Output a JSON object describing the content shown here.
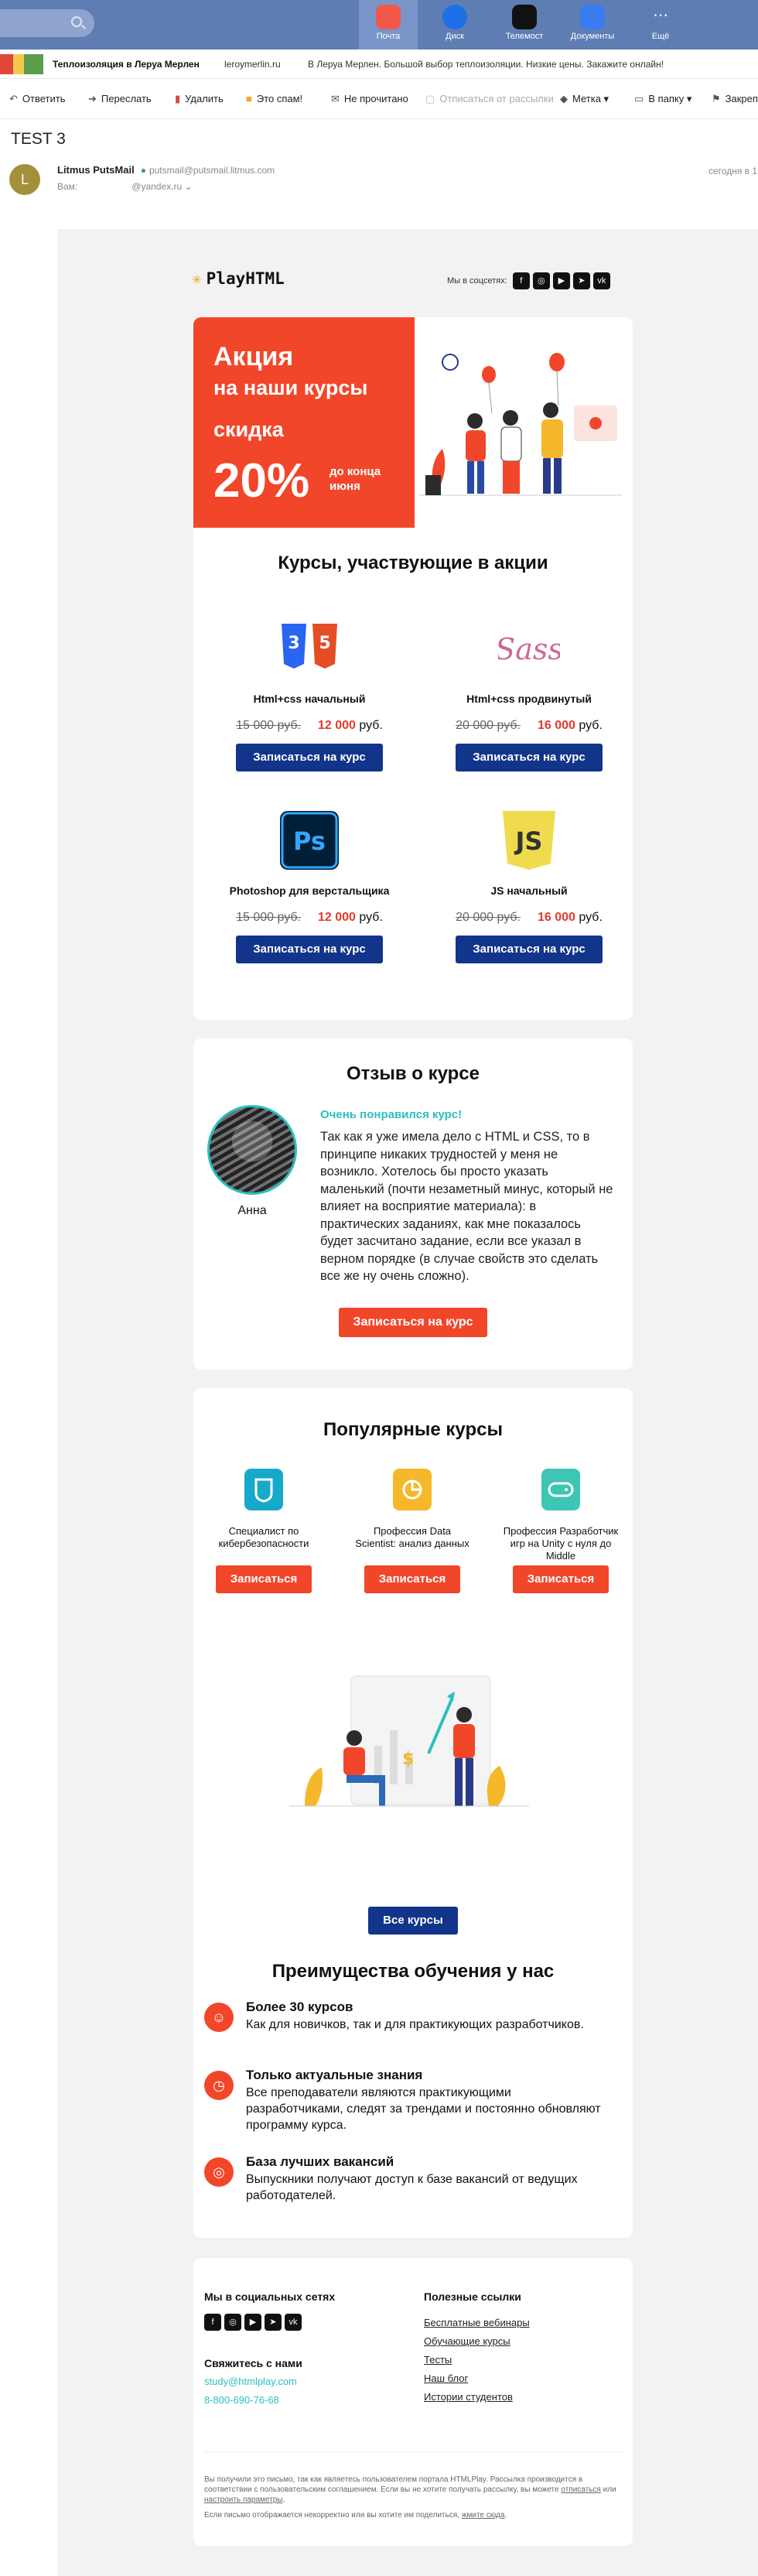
{
  "topbar": {
    "apps": [
      {
        "label": "Почта",
        "color": "#f2594b"
      },
      {
        "label": "Диск",
        "color": "#1e6fe8"
      },
      {
        "label": "Телемост",
        "color": "#111111"
      },
      {
        "label": "Документы",
        "color": "#3b7bf0"
      },
      {
        "label": "Ещё",
        "color": "#6b83b8"
      }
    ]
  },
  "ad": {
    "title": "Теплоизоляция в Леруа Мерлен",
    "domain": "leroymerlin.ru",
    "text": "В Леруа Мерлен. Большой выбор теплоизоляции. Низкие цены. Закажите онлайн!"
  },
  "toolbar": {
    "reply": "Ответить",
    "forward": "Переслать",
    "delete": "Удалить",
    "spam": "Это спам!",
    "unread": "Не прочитано",
    "unsubscribe": "Отписаться от рассылки",
    "label": "Метка",
    "folder": "В папку",
    "pin": "Закреп"
  },
  "mail": {
    "subject": "TEST 3",
    "avatar_letter": "L",
    "sender_name": "Litmus PutsMail",
    "sender_email": "putsmail@putsmail.litmus.com",
    "to_label": "Вам:",
    "to_email": "@yandex.ru",
    "date": "сегодня в 1"
  },
  "email": {
    "logo": "PlayHTML",
    "social_label": "Мы в соцсетях:",
    "hero": {
      "line1": "Акция",
      "line2": "на наши курсы",
      "line3": "скидка",
      "percent": "20%",
      "deadline": "до конца\nиюня"
    },
    "courses_title": "Курсы, участвующие в акции",
    "courses": [
      {
        "name": "Html+css начальный",
        "old": "15 000 руб.",
        "new": "12 000",
        "cur": "руб.",
        "cta": "Записаться на курс"
      },
      {
        "name": "Html+css продвинутый",
        "old": "20 000 руб.",
        "new": "16 000",
        "cur": "руб.",
        "cta": "Записаться на курс"
      },
      {
        "name": "Photoshop для верстальщика",
        "old": "15 000 руб.",
        "new": "12 000",
        "cur": "руб.",
        "cta": "Записаться на курс"
      },
      {
        "name": "JS начальный",
        "old": "20 000 руб.",
        "new": "16 000",
        "cur": "руб.",
        "cta": "Записаться на курс"
      }
    ],
    "review": {
      "title": "Отзыв о курсе",
      "headline": "Очень понравился курс!",
      "name": "Анна",
      "text": "Так как я уже имела дело с HTML и CSS, то в принципе никаких трудностей у меня не возникло. Хотелось бы просто указать маленький (почти незаметный минус, который не влияет на восприятие материала): в практических заданиях, как мне показалось будет засчитано задание, если все указал в верном порядке (в случае свойств это сделать все же ну очень сложно).",
      "cta": "Записаться на курс"
    },
    "popular": {
      "title": "Популярные курсы",
      "items": [
        {
          "name": "Специалист по кибербезопасности",
          "cta": "Записаться",
          "color": "#17a9c9"
        },
        {
          "name": "Профессия Data Scientist: анализ данных",
          "cta": "Записаться",
          "color": "#f5b82a"
        },
        {
          "name": "Профессия Разработчик игр на Unity с нуля до Middle",
          "cta": "Записаться",
          "color": "#3ec6b4"
        }
      ],
      "all": "Все курсы"
    },
    "advantages": {
      "title": "Преимущества обучения у нас",
      "items": [
        {
          "title": "Более 30 курсов",
          "text": "Как для новичков, так и для практикующих разработчиков.",
          "icon": "☺"
        },
        {
          "title": "Только актуальные знания",
          "text": "Все преподаватели являются практикующими разработчиками, следят за трендами и постоянно обновляют программу курса.",
          "icon": "◷"
        },
        {
          "title": "База лучших вакансий",
          "text": "Выпускники получают доступ к базе вакансий от ведущих работодателей.",
          "icon": "◎"
        }
      ]
    },
    "footer": {
      "social_title": "Мы в социальных сетях",
      "contact_title": "Свяжитесь с нами",
      "email": "study@htmlplay.com",
      "phone": "8-800-690-76-68",
      "links_title": "Полезные ссылки",
      "links": [
        "Бесплатные вебинары",
        "Обучающие курсы",
        "Тесты",
        "Наш блог",
        "Истории студентов"
      ],
      "legal1": "Вы получили это письмо, так как являетесь пользователем портала HTMLPlay. Рассылка производится в соответствии с пользовательским соглашением. Если вы не хотите получать рассылку, вы можете",
      "legal_link1": "отписаться",
      "legal_or": "или",
      "legal_link2": "настроить параметры",
      "legal2": "Если письмо отображается некорректно или вы хотите им поделиться,",
      "legal_link3": "жмите сюда"
    }
  }
}
